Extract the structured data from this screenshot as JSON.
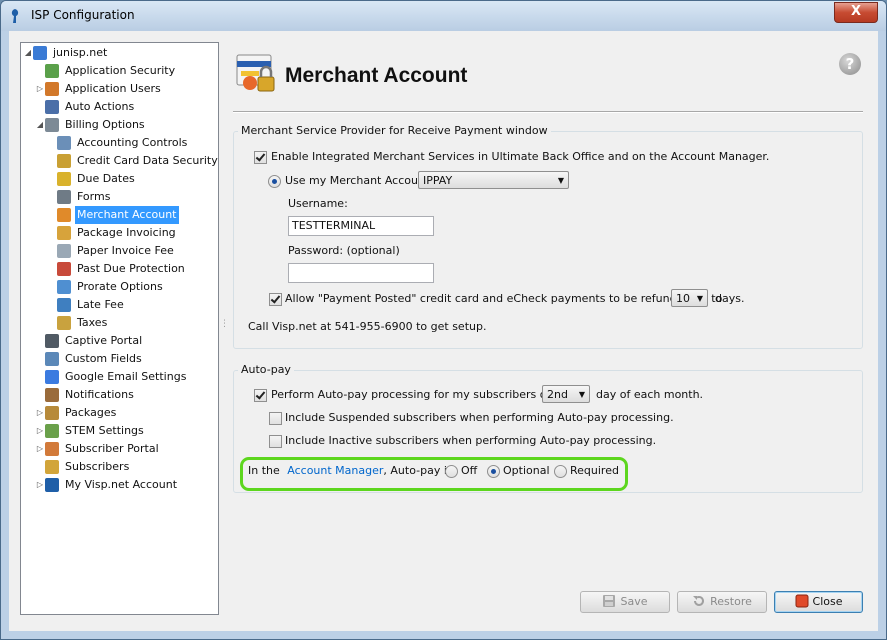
{
  "window": {
    "title": "ISP Configuration",
    "close_glyph": "X"
  },
  "tree": {
    "expanded_glyph": "◢",
    "collapsed_glyph": "▷",
    "items": [
      {
        "label": "junisp.net",
        "icon": "globe-icon",
        "level": 0,
        "expander": "expanded"
      },
      {
        "label": "Application Security",
        "icon": "shield-icon",
        "level": 1,
        "expander": "none"
      },
      {
        "label": "Application Users",
        "icon": "users-icon",
        "level": 1,
        "expander": "collapsed"
      },
      {
        "label": "Auto Actions",
        "icon": "clock-icon",
        "level": 1,
        "expander": "none"
      },
      {
        "label": "Billing Options",
        "icon": "gears-icon",
        "level": 1,
        "expander": "expanded"
      },
      {
        "label": "Accounting Controls",
        "icon": "document-icon",
        "level": 2,
        "expander": "none"
      },
      {
        "label": "Credit Card Data Security",
        "icon": "credit-card-icon",
        "level": 2,
        "expander": "none"
      },
      {
        "label": "Due Dates",
        "icon": "calendar-icon",
        "level": 2,
        "expander": "none"
      },
      {
        "label": "Forms",
        "icon": "printer-icon",
        "level": 2,
        "expander": "none"
      },
      {
        "label": "Merchant Account",
        "icon": "merchant-lock-icon",
        "level": 2,
        "expander": "none",
        "selected": true
      },
      {
        "label": "Package Invoicing",
        "icon": "package-invoice-icon",
        "level": 2,
        "expander": "none"
      },
      {
        "label": "Paper Invoice Fee",
        "icon": "paper-icon",
        "level": 2,
        "expander": "none"
      },
      {
        "label": "Past Due Protection",
        "icon": "warning-document-icon",
        "level": 2,
        "expander": "none"
      },
      {
        "label": "Prorate Options",
        "icon": "prorate-icon",
        "level": 2,
        "expander": "none"
      },
      {
        "label": "Late Fee",
        "icon": "late-fee-icon",
        "level": 2,
        "expander": "none"
      },
      {
        "label": "Taxes",
        "icon": "taxes-icon",
        "level": 2,
        "expander": "none"
      },
      {
        "label": "Captive Portal",
        "icon": "portal-icon",
        "level": 1,
        "expander": "none"
      },
      {
        "label": "Custom Fields",
        "icon": "custom-fields-icon",
        "level": 1,
        "expander": "none"
      },
      {
        "label": "Google Email Settings",
        "icon": "google-icon",
        "level": 1,
        "expander": "none"
      },
      {
        "label": "Notifications",
        "icon": "notification-icon",
        "level": 1,
        "expander": "none"
      },
      {
        "label": "Packages",
        "icon": "packages-icon",
        "level": 1,
        "expander": "collapsed"
      },
      {
        "label": "STEM Settings",
        "icon": "stem-icon",
        "level": 1,
        "expander": "collapsed"
      },
      {
        "label": "Subscriber Portal",
        "icon": "subscriber-portal-icon",
        "level": 1,
        "expander": "collapsed"
      },
      {
        "label": "Subscribers",
        "icon": "subscribers-icon",
        "level": 1,
        "expander": "none"
      },
      {
        "label": "My Visp.net Account",
        "icon": "visp-icon",
        "level": 1,
        "expander": "collapsed"
      }
    ]
  },
  "header": {
    "title": "Merchant Account",
    "help_glyph": "?"
  },
  "merchant_group": {
    "title": "Merchant Service Provider for Receive Payment window",
    "enable_label": "Enable Integrated Merchant Services in Ultimate Back Office and on the Account Manager.",
    "enable_checked": true,
    "use_my_account_label": "Use my Merchant Account:",
    "use_my_account_selected": true,
    "provider_value": "IPPAY",
    "username_label": "Username:",
    "username_value": "TESTTERMINAL",
    "password_label": "Password: (optional)",
    "password_value": "",
    "refund_label": "Allow \"Payment Posted\" credit card and eCheck payments to be refunded up to",
    "refund_checked": true,
    "refund_days_value": "10",
    "refund_suffix": "days.",
    "call_text": "Call Visp.net at 541-955-6900 to get setup."
  },
  "autopay_group": {
    "title": "Auto-pay",
    "perform_label": "Perform Auto-pay processing for my subscribers on the",
    "perform_checked": true,
    "day_value": "2nd",
    "day_suffix": "day of each month.",
    "suspended_label": "Include Suspended subscribers when performing Auto-pay processing.",
    "suspended_checked": false,
    "inactive_label": "Include Inactive subscribers when performing Auto-pay processing.",
    "inactive_checked": false,
    "in_the_text": "In the",
    "account_manager_link": "Account Manager",
    "autopay_is_text": ", Auto-pay is:",
    "off_label": "Off",
    "optional_label": "Optional",
    "required_label": "Required",
    "selected_mode": "Optional",
    "highlight_color": "#5dd61e"
  },
  "buttons": {
    "save": "Save",
    "restore": "Restore",
    "close": "Close"
  },
  "dropdown_glyph": "▼"
}
